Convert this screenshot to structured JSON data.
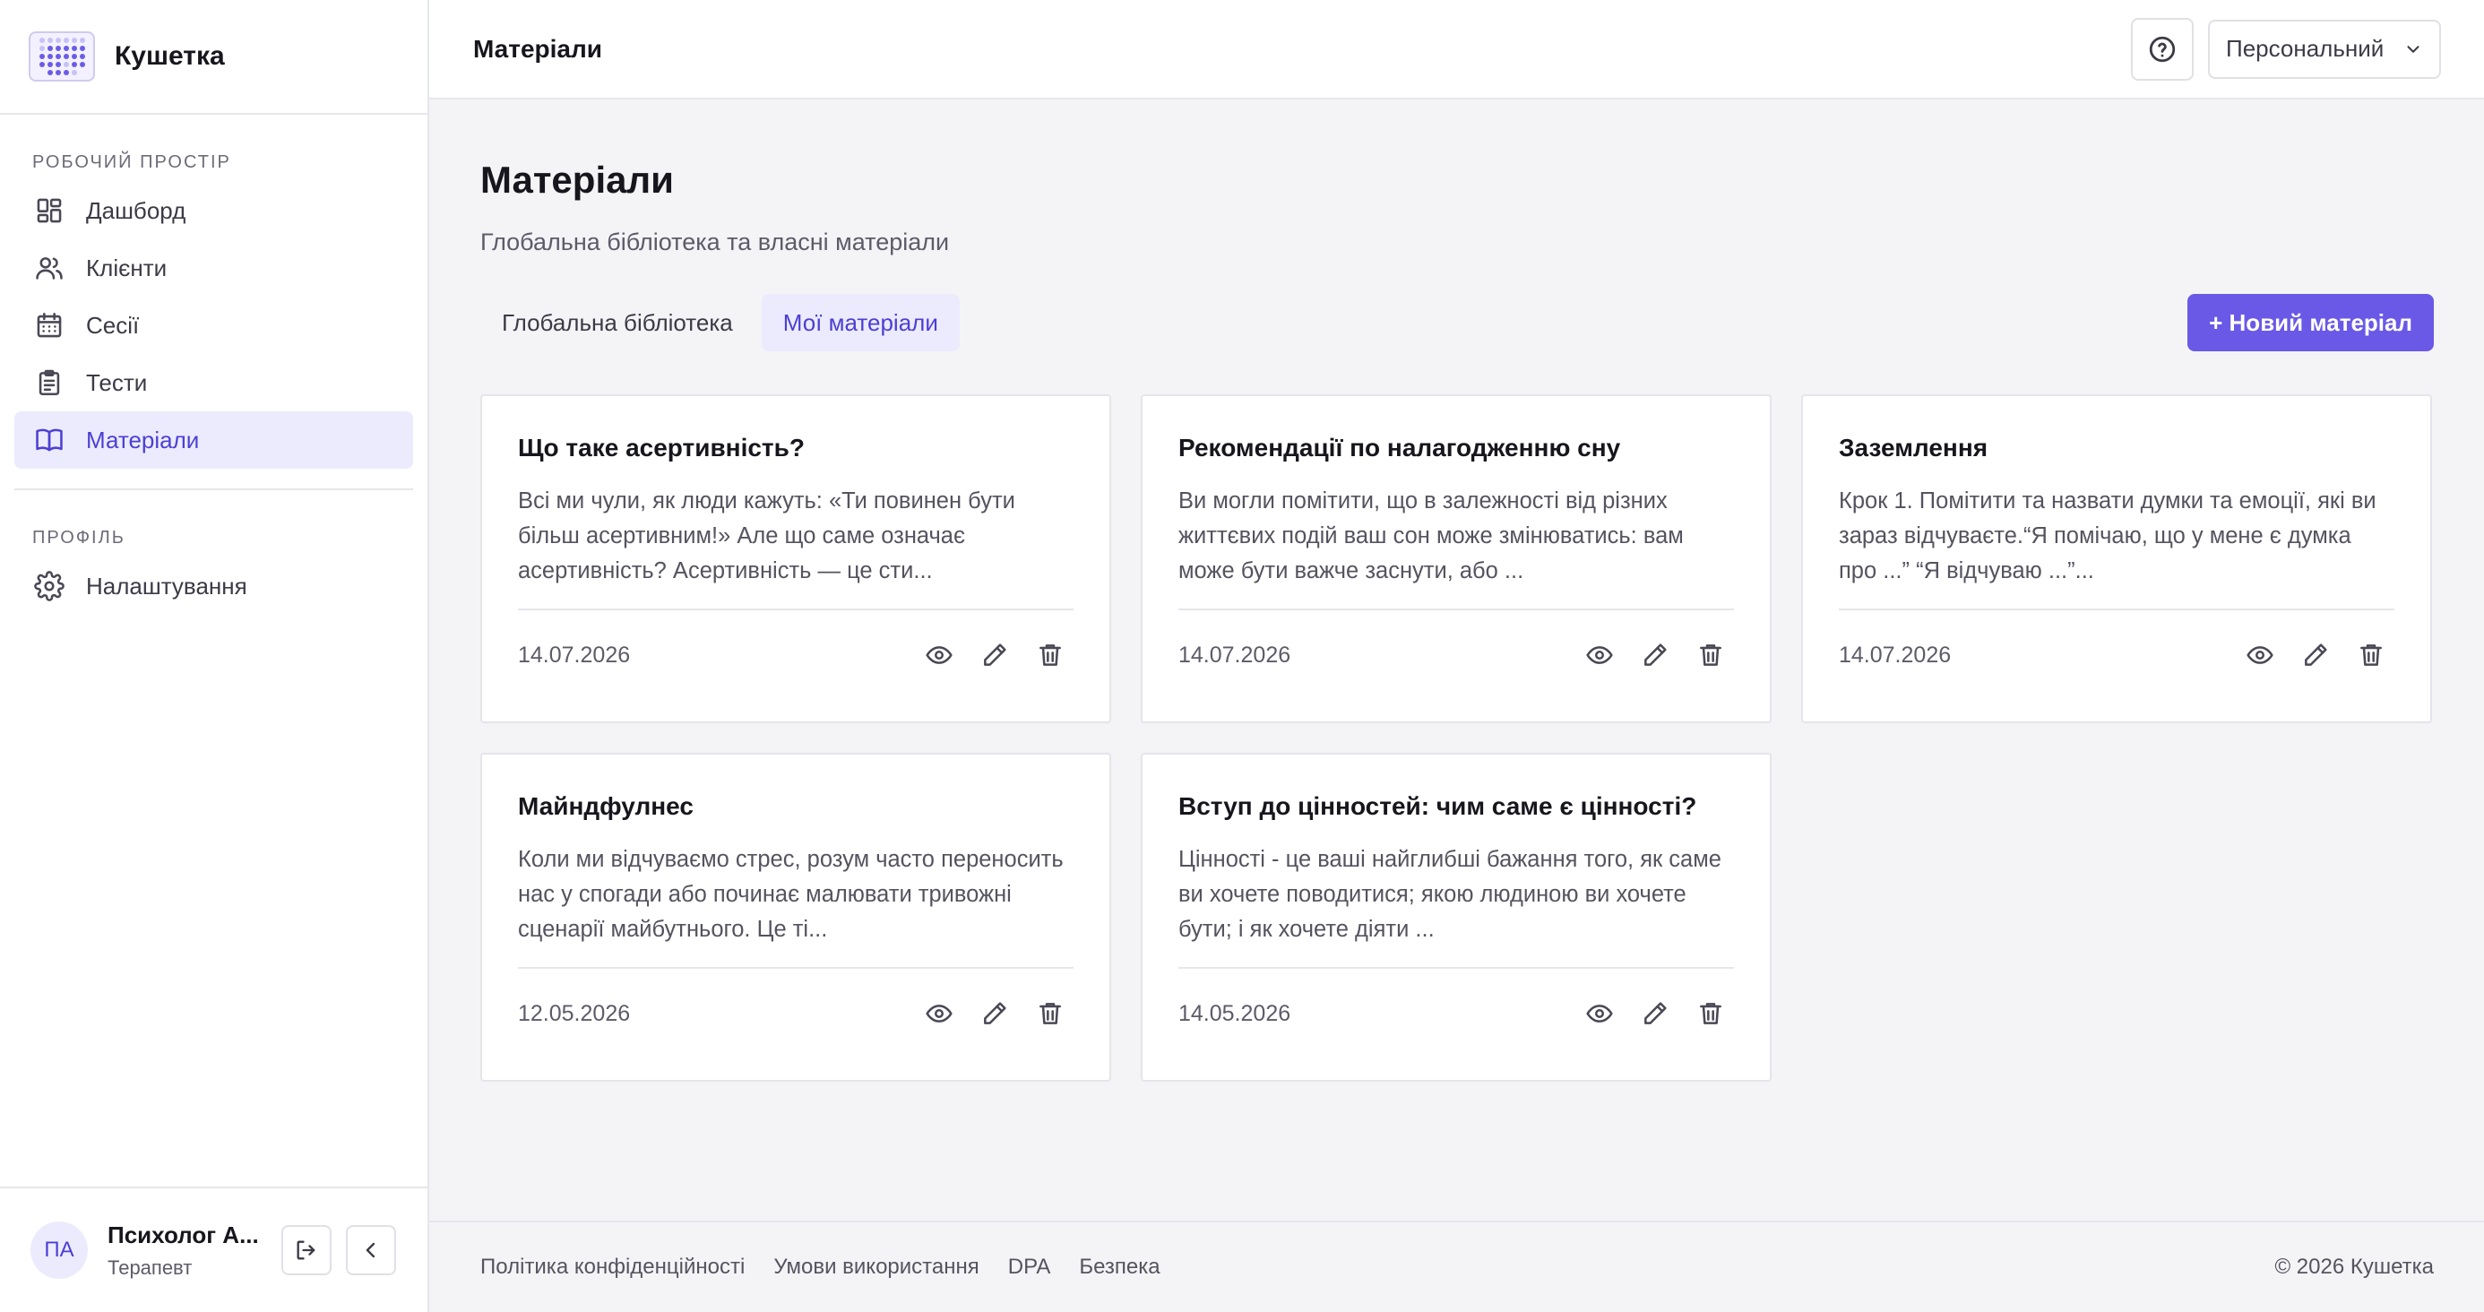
{
  "brand": {
    "name": "Кушетка"
  },
  "sidebar": {
    "workspace_label": "Робочий простір",
    "workspace_items": [
      {
        "label": "Дашборд",
        "icon": "dashboard-icon"
      },
      {
        "label": "Клієнти",
        "icon": "users-icon"
      },
      {
        "label": "Сесії",
        "icon": "calendar-icon"
      },
      {
        "label": "Тести",
        "icon": "clipboard-icon"
      },
      {
        "label": "Матеріали",
        "icon": "book-icon",
        "active": true
      }
    ],
    "profile_label": "Профіль",
    "profile_items": [
      {
        "label": "Налаштування",
        "icon": "gear-icon"
      }
    ],
    "user": {
      "initials": "ПА",
      "name": "Психолог А...",
      "role": "Терапевт"
    }
  },
  "topbar": {
    "title": "Матеріали",
    "workspace_select": "Персональний"
  },
  "page": {
    "title": "Матеріали",
    "subtitle": "Глобальна бібліотека та власні матеріали",
    "tabs": [
      {
        "label": "Глобальна бібліотека"
      },
      {
        "label": "Мої матеріали",
        "active": true
      }
    ],
    "new_button": "+ Новий матеріал"
  },
  "materials": [
    {
      "title": "Що таке асертивність?",
      "excerpt": "Всі ми чули, як люди кажуть: «Ти повинен бути більш асертивним!» Але що саме означає асертивність? Асертивність — це сти...",
      "date": "14.07.2026"
    },
    {
      "title": "Рекомендації по налагодженню сну",
      "excerpt": "Ви могли помітити, що в залежності від різних життєвих подій ваш сон може змінюватись: вам може бути важче заснути, або ...",
      "date": "14.07.2026"
    },
    {
      "title": "Заземлення",
      "excerpt": "Крок 1. Помітити та назвати думки та емоції, які ви зараз відчуваєте.“Я помічаю, що у мене є думка про ...” “Я відчуваю ...”...",
      "date": "14.07.2026"
    },
    {
      "title": "Майндфулнес",
      "excerpt": "Коли ми відчуваємо стрес, розум часто переносить нас у спогади або починає малювати тривожні сценарії майбутнього. Це ті...",
      "date": "12.05.2026"
    },
    {
      "title": "Вступ до цінностей: чим саме є цінності?",
      "excerpt": "Цінності - це ваші найглибші бажання того, як саме ви хочете поводитися; якою людиною ви хочете бути; і як хочете діяти ...",
      "date": "14.05.2026"
    }
  ],
  "footer": {
    "links": [
      "Політика конфіденційності",
      "Умови використання",
      "DPA",
      "Безпека"
    ],
    "copyright": "© 2026 Кушетка"
  },
  "colors": {
    "accent": "#6a59e6",
    "accent_soft": "#ecebfd"
  }
}
